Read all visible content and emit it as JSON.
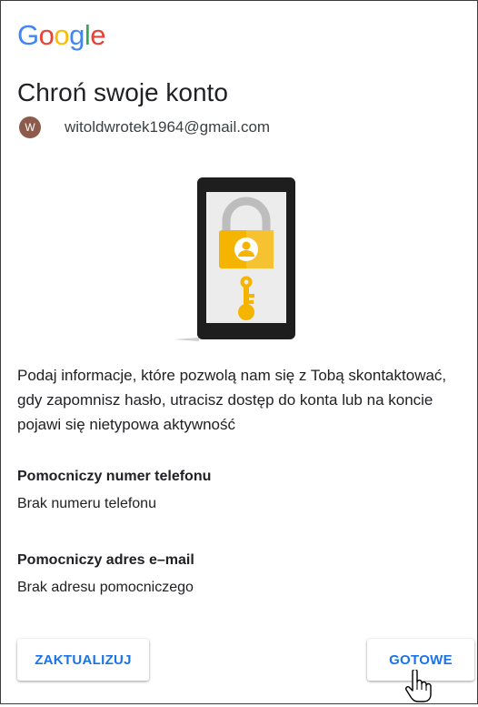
{
  "logo": {
    "letters": [
      {
        "char": "G",
        "color": "#4285F4"
      },
      {
        "char": "o",
        "color": "#EA4335"
      },
      {
        "char": "o",
        "color": "#FBBC05"
      },
      {
        "char": "g",
        "color": "#4285F4"
      },
      {
        "char": "l",
        "color": "#34A853"
      },
      {
        "char": "e",
        "color": "#EA4335"
      }
    ]
  },
  "page": {
    "title": "Chroń swoje konto"
  },
  "account": {
    "avatar_initial": "W",
    "avatar_color": "#8d5b4c",
    "email": "witoldwrotek1964@gmail.com"
  },
  "illustration": {
    "icon": "phone-lock-key-icon",
    "accent_color": "#f4b400"
  },
  "description": "Podaj informacje, które pozwolą nam się z Tobą skontaktować, gdy zapomnisz hasło, utracisz dostęp do konta lub na koncie pojawi się nietypowa aktywność",
  "recovery_phone": {
    "label": "Pomocniczy numer telefonu",
    "value": "Brak numeru telefonu"
  },
  "recovery_email": {
    "label": "Pomocniczy adres e–mail",
    "value": "Brak adresu pomocniczego"
  },
  "actions": {
    "update_label": "ZAKTUALIZUJ",
    "done_label": "GOTOWE",
    "accent_color": "#1a73e8"
  },
  "cursor": {
    "icon": "hand-pointer-icon"
  }
}
